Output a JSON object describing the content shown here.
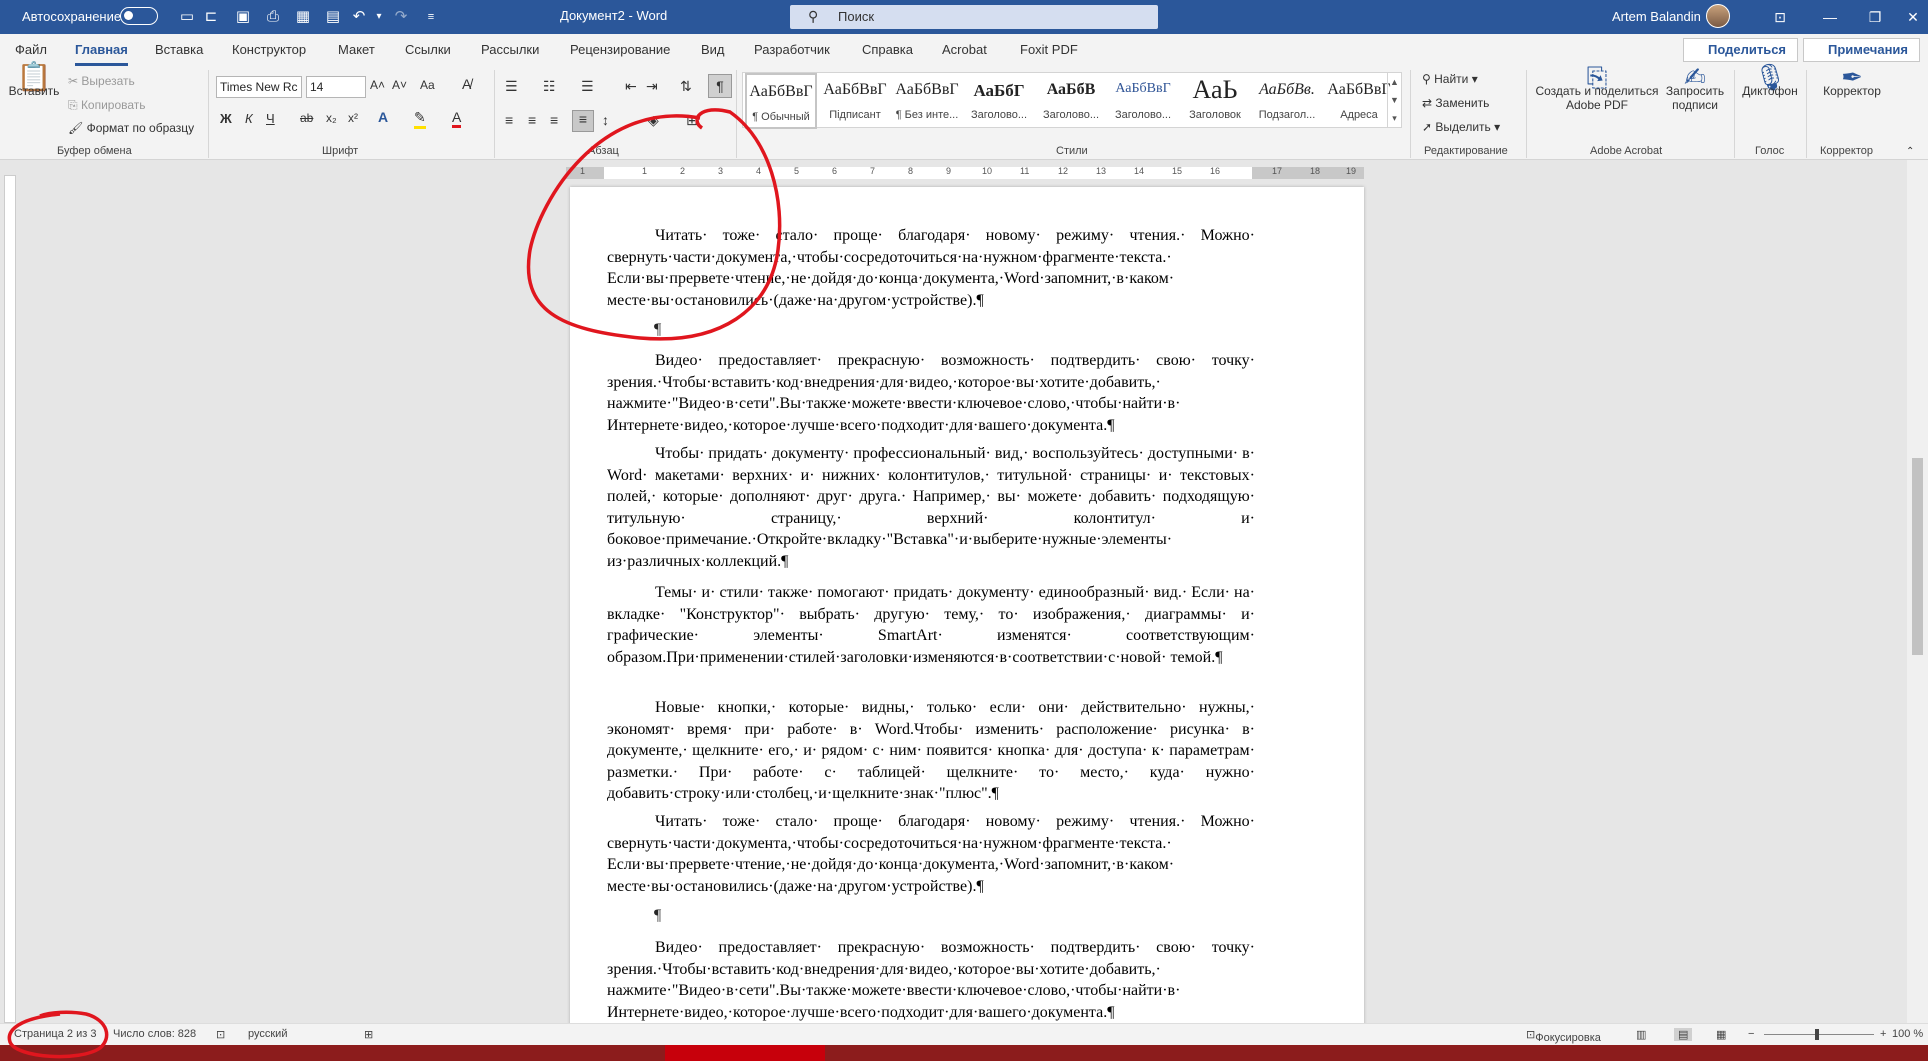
{
  "titlebar": {
    "autosave_label": "Автосохранение",
    "document_title": "Документ2 - Word",
    "search_placeholder": "Поиск",
    "user_name": "Artem Balandin"
  },
  "tabs": [
    "Файл",
    "Главная",
    "Вставка",
    "Конструктор",
    "Макет",
    "Ссылки",
    "Рассылки",
    "Рецензирование",
    "Вид",
    "Разработчик",
    "Справка",
    "Acrobat",
    "Foxit PDF"
  ],
  "actions": {
    "share": "Поделиться",
    "comments": "Примечания"
  },
  "clipboard": {
    "paste": "Вставить",
    "cut": "Вырезать",
    "copy": "Копировать",
    "format_painter": "Формат по образцу",
    "group": "Буфер обмена"
  },
  "font": {
    "name": "Times New Rc",
    "size": "14",
    "group": "Шрифт",
    "grow": "A˄",
    "shrink": "A˅",
    "case": "Aa",
    "bold": "Ж",
    "italic": "К",
    "underline": "Ч",
    "strike": "ab",
    "sub": "x₂",
    "sup": "x²"
  },
  "paragraph": {
    "group": "Абзац",
    "pilcrow": "¶"
  },
  "styles": {
    "group": "Стили",
    "items": [
      {
        "preview": "АаБбВвГ",
        "name": "¶ Обычный"
      },
      {
        "preview": "АаБбВвГ",
        "name": "Підписант"
      },
      {
        "preview": "АаБбВвГ",
        "name": "¶ Без инте..."
      },
      {
        "preview": "АаБбГ",
        "name": "Заголово..."
      },
      {
        "preview": "АаБбВ",
        "name": "Заголово..."
      },
      {
        "preview": "АаБбВвГ",
        "name": "Заголово..."
      },
      {
        "preview": "АаЬ",
        "name": "Заголовок"
      },
      {
        "preview": "АаБбВв.",
        "name": "Подзагол..."
      },
      {
        "preview": "АаБбВвГ",
        "name": "Адреса"
      }
    ]
  },
  "editing": {
    "find": "Найти",
    "replace": "Заменить",
    "select": "Выделить",
    "group": "Редактирование"
  },
  "acrobat": {
    "create_share": "Создать и поделиться Adobe PDF",
    "request_sign": "Запросить подписи",
    "group": "Adobe Acrobat"
  },
  "voice": {
    "dictate": "Диктофон",
    "group": "Голос"
  },
  "corrector": {
    "label": "Корректор",
    "group": "Корректор"
  },
  "ruler": {
    "numbers": [
      "1",
      "1",
      "2",
      "3",
      "4",
      "5",
      "6",
      "7",
      "8",
      "9",
      "10",
      "11",
      "12",
      "13",
      "14",
      "15",
      "16",
      "17",
      "18",
      "19"
    ]
  },
  "document": {
    "paragraphs": [
      "Читать· тоже· стало· проще· благодаря· новому· режиму· чтения.· Можно· свернуть·части·документа,·чтобы·сосредоточиться·на·нужном·фрагменте·текста.· Если·вы·прервете·чтение,·не·дойдя·до·конца·документа,·Word·запомнит,·в·каком· месте·вы·остановились·(даже·на·другом·устройстве).¶",
      "Видео· предоставляет· прекрасную· возможность· подтвердить· свою· точку· зрения.·Чтобы·вставить·код·внедрения·для·видео,·которое·вы·хотите·добавить,· нажмите·\"Видео·в·сети\".Вы·также·можете·ввести·ключевое·слово,·чтобы·найти·в· Интернете·видео,·которое·лучше·всего·подходит·для·вашего·документа.¶",
      "Чтобы· придать· документу· профессиональный· вид,· воспользуйтесь· доступными· в· Word· макетами· верхних· и· нижних· колонтитулов,· титульной· страницы· и· текстовых· полей,· которые· дополняют· друг· друга.· Например,· вы· можете· добавить· подходящую· титульную· страницу,· верхний· колонтитул· и· боковое·примечание.·Откройте·вкладку·\"Вставка\"·и·выберите·нужные·элементы· из·различных·коллекций.¶",
      "Темы· и· стили· также· помогают· придать· документу· единообразный· вид.· Если· на· вкладке· \"Конструктор\"· выбрать· другую· тему,· то· изображения,· диаграммы· и· графические· элементы· SmartArt· изменятся· соответствующим· образом.При·применении·стилей·заголовки·изменяются·в·соответствии·с·новой· темой.¶",
      "Новые· кнопки,· которые· видны,· только· если· они· действительно· нужны,· экономят· время· при· работе· в· Word.Чтобы· изменить· расположение· рисунка· в· документе,· щелкните· его,· и· рядом· с· ним· появится· кнопка· для· доступа· к· параметрам· разметки.· При· работе· с· таблицей· щелкните· то· место,· куда· нужно· добавить·строку·или·столбец,·и·щелкните·знак·\"плюс\".¶",
      "Читать· тоже· стало· проще· благодаря· новому· режиму· чтения.· Можно· свернуть·части·документа,·чтобы·сосредоточиться·на·нужном·фрагменте·текста.· Если·вы·прервете·чтение,·не·дойдя·до·конца·документа,·Word·запомнит,·в·каком· месте·вы·остановились·(даже·на·другом·устройстве).¶",
      "Видео· предоставляет· прекрасную· возможность· подтвердить· свою· точку· зрения.·Чтобы·вставить·код·внедрения·для·видео,·которое·вы·хотите·добавить,· нажмите·\"Видео·в·сети\".Вы·также·можете·ввести·ключевое·слово,·чтобы·найти·в· Интернете·видео,·которое·лучше·всего·подходит·для·вашего·документа.¶"
    ],
    "empty_mark": "¶"
  },
  "status": {
    "page": "Страница 2 из 3",
    "words": "Число слов: 828",
    "language": "русский",
    "focus": "Фокусировка",
    "zoom": "100 %",
    "zoom_minus": "−",
    "zoom_plus": "+"
  },
  "colors": {
    "accent": "#2b579a",
    "annotation": "#e0161e",
    "taskbar": "#8c1c1c"
  }
}
